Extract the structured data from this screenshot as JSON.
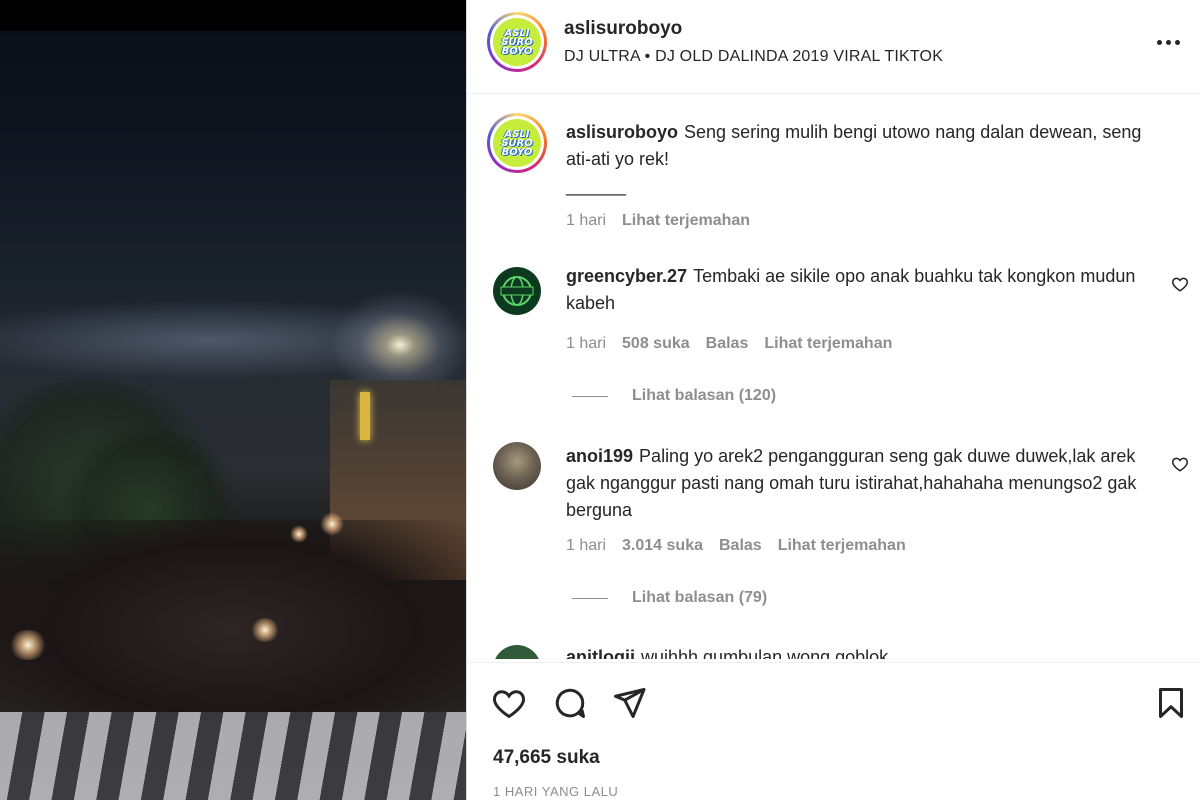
{
  "header": {
    "username": "aslisuroboyo",
    "audio": "DJ ULTRA • DJ OLD DALINDA 2019 VIRAL TIKTOK",
    "avatar_logo": "ASLI SURO BOYO",
    "more_icon": "more-horizontal-icon"
  },
  "caption": {
    "username": "aslisuroboyo",
    "text": "Seng sering mulih bengi utowo nang dalan dewean, seng ati-ati yo rek!",
    "separator": "______",
    "time": "1 hari",
    "translate": "Lihat terjemahan"
  },
  "comments": [
    {
      "username": "greencyber.27",
      "text": "Tembaki ae sikile opo anak buahku tak kongkon mudun kabeh",
      "time": "1 hari",
      "likes": "508 suka",
      "reply": "Balas",
      "translate": "Lihat terjemahan",
      "view_replies": "Lihat balasan (120)"
    },
    {
      "username": "anoi199",
      "text": "Paling yo arek2 pengangguran seng gak duwe duwek,lak arek gak nganggur pasti nang omah turu istirahat,hahahaha menungso2 gak berguna",
      "time": "1 hari",
      "likes": "3.014 suka",
      "reply": "Balas",
      "translate": "Lihat terjemahan",
      "view_replies": "Lihat balasan (79)"
    },
    {
      "username": "anitlogii",
      "text": "wuihhh gumbulan wong goblok"
    }
  ],
  "actions": {
    "like_icon": "heart-icon",
    "comment_icon": "comment-icon",
    "share_icon": "send-icon",
    "save_icon": "bookmark-icon",
    "likes": "47,665 suka",
    "posted": "1 HARI YANG LALU"
  }
}
